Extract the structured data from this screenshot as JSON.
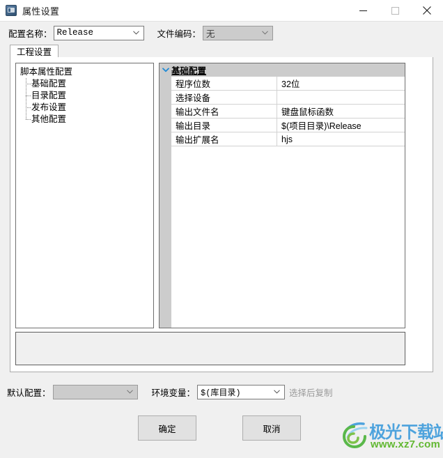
{
  "window": {
    "title": "属性设置",
    "icon": "app-icon",
    "controls": {
      "minimize": "minimize-icon",
      "maximize": "maximize-icon",
      "close": "close-icon"
    }
  },
  "top_bar": {
    "config_name_label": "配置名称：",
    "config_name_value": "Release",
    "encoding_label": "文件编码：",
    "encoding_value": "无"
  },
  "tabs": [
    {
      "label": "工程设置",
      "selected": true
    }
  ],
  "tree": {
    "root": "脚本属性配置",
    "items": [
      {
        "label": "基础配置"
      },
      {
        "label": "目录配置"
      },
      {
        "label": "发布设置"
      },
      {
        "label": "其他配置"
      }
    ]
  },
  "property_grid": {
    "category": "基础配置",
    "chevron": "chevron-down-icon",
    "rows": [
      {
        "name": "程序位数",
        "value": "32位"
      },
      {
        "name": "选择设备",
        "value": ""
      },
      {
        "name": "输出文件名",
        "value": "键盘鼠标函数"
      },
      {
        "name": "输出目录",
        "value": "$(项目目录)\\Release"
      },
      {
        "name": "输出扩展名",
        "value": "hjs"
      }
    ]
  },
  "description_box": {
    "text": ""
  },
  "bottom_bar": {
    "default_config_label": "默认配置：",
    "default_config_value": "",
    "env_var_label": "环境变量：",
    "env_var_value": "$(库目录)",
    "copy_hint": "选择后复制"
  },
  "dialog_buttons": {
    "ok": "确定",
    "cancel": "取消"
  },
  "watermark": {
    "title": "极光下载站",
    "url": "www.xz7.com"
  },
  "colors": {
    "window_bg": "#f0f0f0",
    "titlebar_bg": "#ffffff",
    "category_bg": "#cccccc",
    "chevron": "#1e8ad6",
    "watermark_title": "#4ea3dd",
    "watermark_url": "#62b832",
    "hint_text": "#9a9a9a"
  }
}
